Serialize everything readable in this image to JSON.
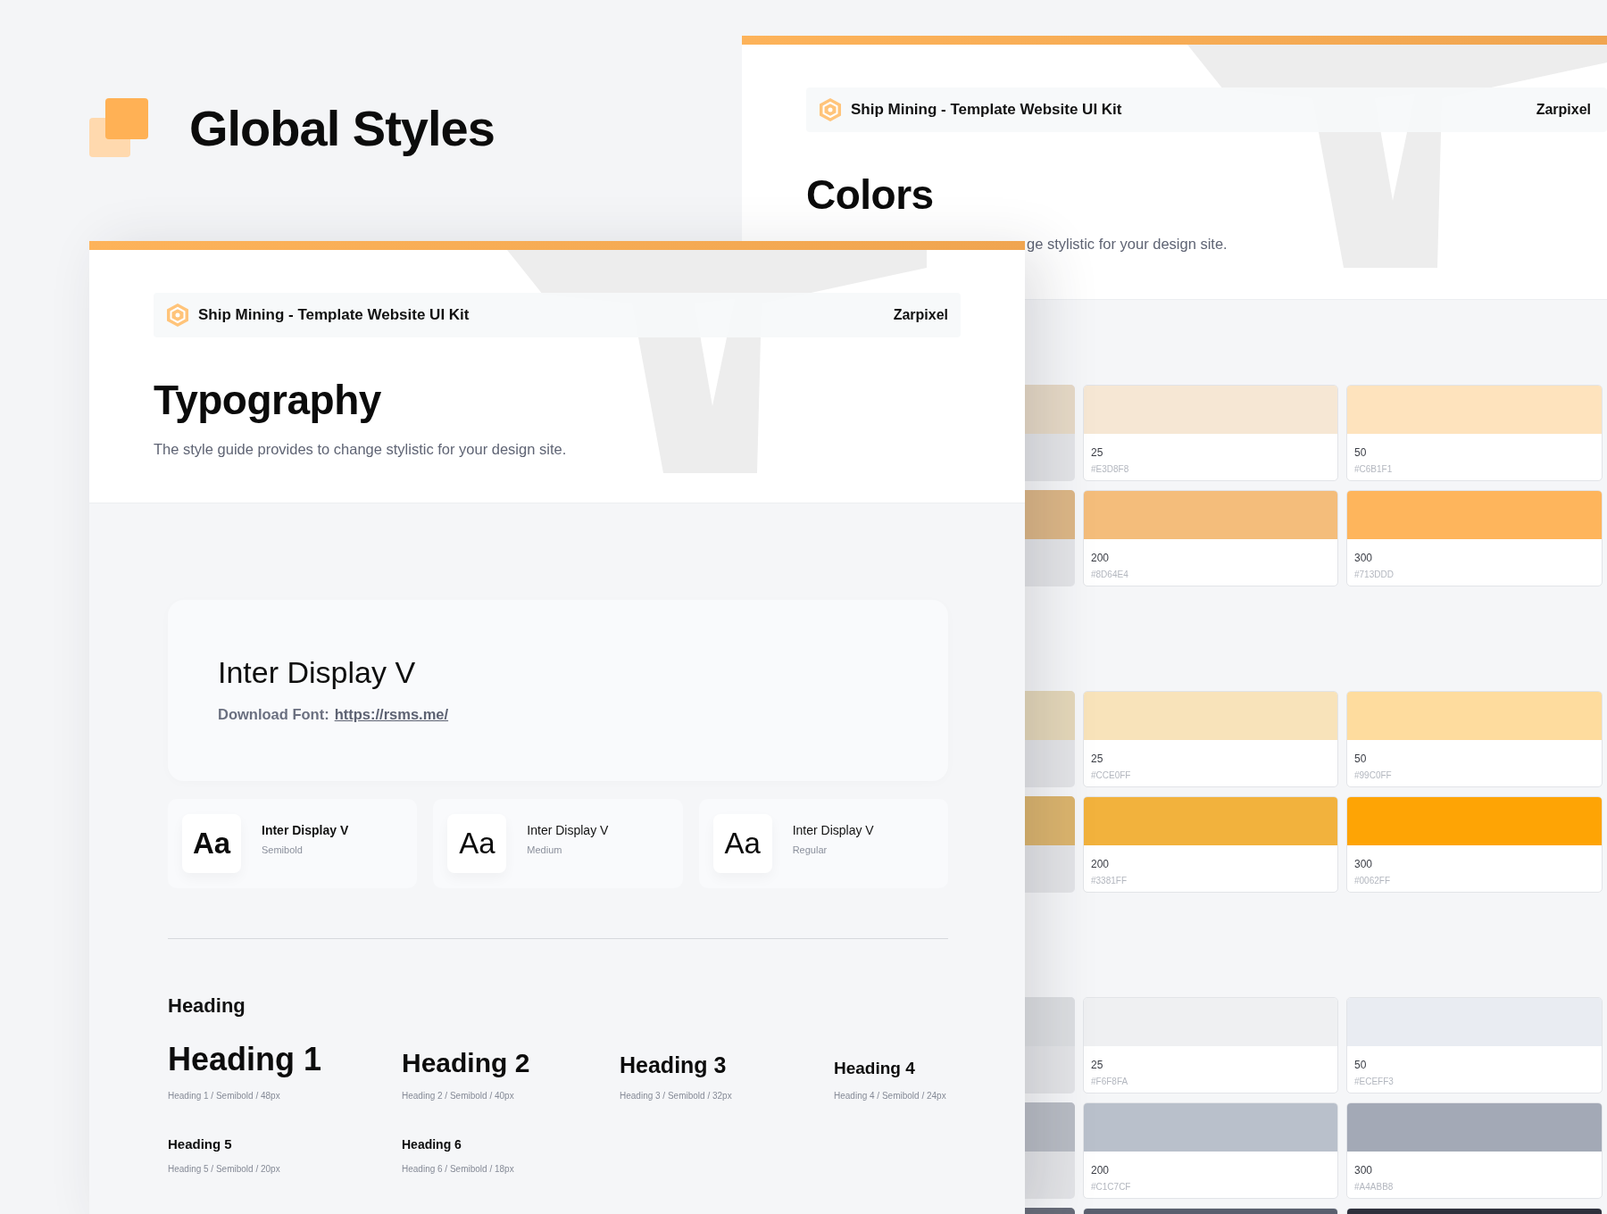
{
  "title": "Global Styles",
  "colors_page": {
    "brand": "Ship Mining - Template Website UI Kit",
    "author": "Zarpixel",
    "title": "Colors",
    "subtitle": "ge stylistic for your design site.",
    "groups": [
      {
        "rows": [
          {
            "stub": {
              "color": "#e6d9c6"
            },
            "swatches": [
              {
                "label": "25",
                "hex": "#E3D8F8",
                "color": "#f6e7d4"
              },
              {
                "label": "50",
                "hex": "#C6B1F1",
                "color": "#fee3bd"
              }
            ]
          },
          {
            "stub": {
              "color": "#dcb686"
            },
            "swatches": [
              {
                "label": "200",
                "hex": "#8D64E4",
                "color": "#f4bd7b"
              },
              {
                "label": "300",
                "hex": "#713DDD",
                "color": "#feb55c"
              }
            ]
          }
        ]
      },
      {
        "rows": [
          {
            "stub": {
              "color": "#e4d7b9"
            },
            "swatches": [
              {
                "label": "25",
                "hex": "#CCE0FF",
                "color": "#f8e3ba"
              },
              {
                "label": "50",
                "hex": "#99C0FF",
                "color": "#fedc9e"
              }
            ]
          },
          {
            "stub": {
              "color": "#dbb46d"
            },
            "swatches": [
              {
                "label": "200",
                "hex": "#3381FF",
                "color": "#f2b23d"
              },
              {
                "label": "300",
                "hex": "#0062FF",
                "color": "#fea405"
              }
            ]
          }
        ]
      },
      {
        "rows": [
          {
            "stub": {
              "color": "#dcdee1"
            },
            "swatches": [
              {
                "label": "25",
                "hex": "#F6F8FA",
                "color": "#eff0f2"
              },
              {
                "label": "50",
                "hex": "#ECEFF3",
                "color": "#e9ecf2"
              }
            ]
          },
          {
            "stub": {
              "color": "#b8bcc4"
            },
            "swatches": [
              {
                "label": "200",
                "hex": "#C1C7CF",
                "color": "#b9c0cb"
              },
              {
                "label": "300",
                "hex": "#A4ABB8",
                "color": "#a3a9b6"
              }
            ]
          },
          {
            "stub": {
              "color": "#676b78"
            },
            "swatches": [
              {
                "color": "#5a5f6e"
              },
              {
                "color": "#2e303c"
              }
            ]
          }
        ]
      }
    ]
  },
  "typography_page": {
    "brand": "Ship Mining - Template Website UI Kit",
    "author": "Zarpixel",
    "title": "Typography",
    "subtitle": "The style guide provides to change stylistic for your design site.",
    "font": {
      "name": "Inter Display V",
      "download_label": "Download Font:",
      "download_link": "https://rsms.me/"
    },
    "weights": [
      {
        "sample": "Aa",
        "name": "Inter Display V",
        "weight": "Semibold",
        "kind": "semibold"
      },
      {
        "sample": "Aa",
        "name": "Inter Display V",
        "weight": "Medium",
        "kind": "medium"
      },
      {
        "sample": "Aa",
        "name": "Inter Display V",
        "weight": "Regular",
        "kind": "regular"
      }
    ],
    "section": "Heading",
    "headings": [
      {
        "text": "Heading 1",
        "caption": "Heading 1 / Semibold / 48px",
        "kind": "h1"
      },
      {
        "text": "Heading 2",
        "caption": "Heading 2 / Semibold / 40px",
        "kind": "h2"
      },
      {
        "text": "Heading 3",
        "caption": "Heading 3 / Semibold / 32px",
        "kind": "h3"
      },
      {
        "text": "Heading 4",
        "caption": "Heading 4 / Semibold / 24px",
        "kind": "h4"
      },
      {
        "text": "Heading 5",
        "caption": "Heading 5 / Semibold / 20px",
        "kind": "h5"
      },
      {
        "text": "Heading 6",
        "caption": "Heading 6 / Semibold / 18px",
        "kind": "h6"
      }
    ]
  }
}
